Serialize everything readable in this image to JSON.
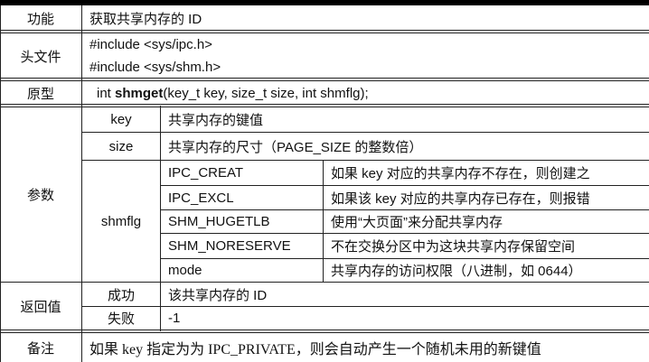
{
  "rows": {
    "function": {
      "label": "功能",
      "value": "获取共享内存的 ID"
    },
    "header": {
      "label": "头文件",
      "lines": [
        "#include <sys/ipc.h>",
        "#include <sys/shm.h>"
      ]
    },
    "prototype": {
      "label": "原型",
      "prefix": "int ",
      "name": "shmget",
      "suffix": "(key_t key, size_t size, int shmflg);"
    },
    "params": {
      "label": "参数",
      "key": {
        "name": "key",
        "desc": "共享内存的键值"
      },
      "size": {
        "name": "size",
        "desc": "共享内存的尺寸（PAGE_SIZE 的整数倍）"
      },
      "shmflg": {
        "name": "shmflg",
        "flags": [
          {
            "name": "IPC_CREAT",
            "desc": "如果 key 对应的共享内存不存在，则创建之"
          },
          {
            "name": "IPC_EXCL",
            "desc": "如果该 key 对应的共享内存已存在，则报错"
          },
          {
            "name": "SHM_HUGETLB",
            "desc": "使用“大页面”来分配共享内存"
          },
          {
            "name": "SHM_NORESERVE",
            "desc": "不在交换分区中为这块共享内存保留空间"
          },
          {
            "name": "mode",
            "desc": "共享内存的访问权限（八进制，如 0644）"
          }
        ]
      }
    },
    "return": {
      "label": "返回值",
      "success_label": "成功",
      "success_value": "该共享内存的 ID",
      "failure_label": "失败",
      "failure_value": "-1"
    },
    "note": {
      "label": "备注",
      "value": "如果 key 指定为为 IPC_PRIVATE，则会自动产生一个随机未用的新键值"
    }
  }
}
